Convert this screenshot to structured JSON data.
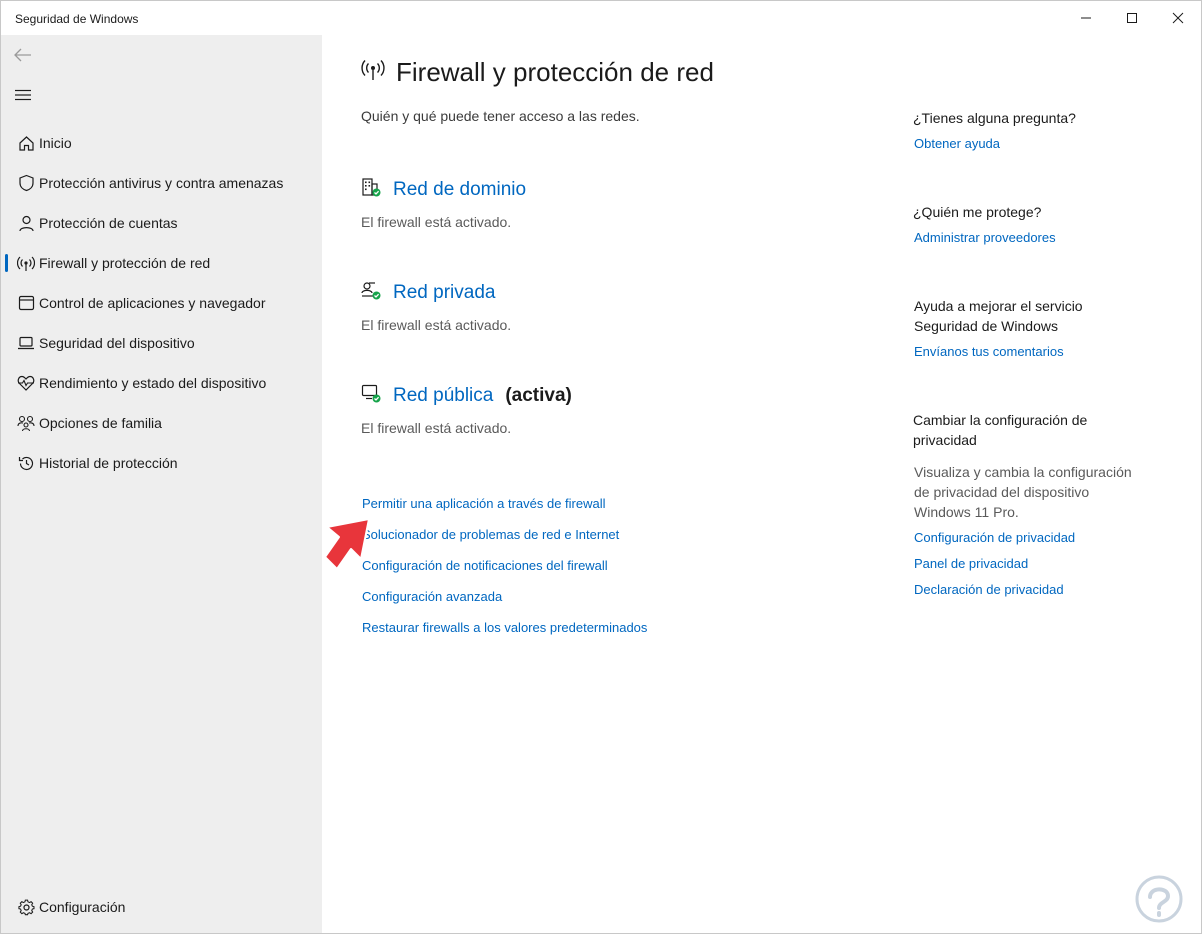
{
  "window": {
    "title": "Seguridad de Windows"
  },
  "sidebar": {
    "items": [
      {
        "label": "Inicio",
        "icon": "home-icon"
      },
      {
        "label": "Protección antivirus y contra amenazas",
        "icon": "shield-icon"
      },
      {
        "label": "Protección de cuentas",
        "icon": "person-icon"
      },
      {
        "label": "Firewall y protección de red",
        "icon": "wifi-antenna-icon",
        "active": true
      },
      {
        "label": "Control de aplicaciones y navegador",
        "icon": "app-window-icon"
      },
      {
        "label": "Seguridad del dispositivo",
        "icon": "laptop-icon"
      },
      {
        "label": "Rendimiento y estado del dispositivo",
        "icon": "heart-pulse-icon"
      },
      {
        "label": "Opciones de familia",
        "icon": "family-icon"
      },
      {
        "label": "Historial de protección",
        "icon": "history-icon"
      }
    ],
    "settings_label": "Configuración"
  },
  "main": {
    "title": "Firewall y protección de red",
    "subtitle": "Quién y qué puede tener acceso a las redes.",
    "networks": [
      {
        "name": "Red de dominio",
        "status": "El firewall está activado.",
        "tag": ""
      },
      {
        "name": "Red privada",
        "status": "El firewall está activado.",
        "tag": ""
      },
      {
        "name": "Red pública",
        "status": "El firewall está activado.",
        "tag": "(activa)"
      }
    ],
    "links": [
      "Permitir una aplicación a través de firewall",
      "Solucionador de problemas de red e Internet",
      "Configuración de notificaciones del firewall",
      "Configuración avanzada",
      "Restaurar firewalls a los valores predeterminados"
    ]
  },
  "right_panel": {
    "question_heading": "¿Tienes alguna pregunta?",
    "help_link": "Obtener ayuda",
    "protect_heading": "¿Quién me protege?",
    "providers_link": "Administrar proveedores",
    "improve_heading_1": "Ayuda a mejorar el servicio",
    "improve_heading_2": "Seguridad de Windows",
    "feedback_link": "Envíanos tus comentarios",
    "privacy_heading_1": "Cambiar la configuración de",
    "privacy_heading_2": "privacidad",
    "privacy_text_1": "Visualiza y cambia la configuración",
    "privacy_text_2": "de privacidad del dispositivo",
    "privacy_text_3": "Windows 11 Pro.",
    "privacy_links": [
      "Configuración de privacidad",
      "Panel de privacidad",
      "Declaración de privacidad"
    ]
  },
  "colors": {
    "accent": "#0067c0",
    "sidebar_bg": "#eeeeee",
    "status_ok": "#16a34a",
    "arrow": "#e8353b"
  }
}
